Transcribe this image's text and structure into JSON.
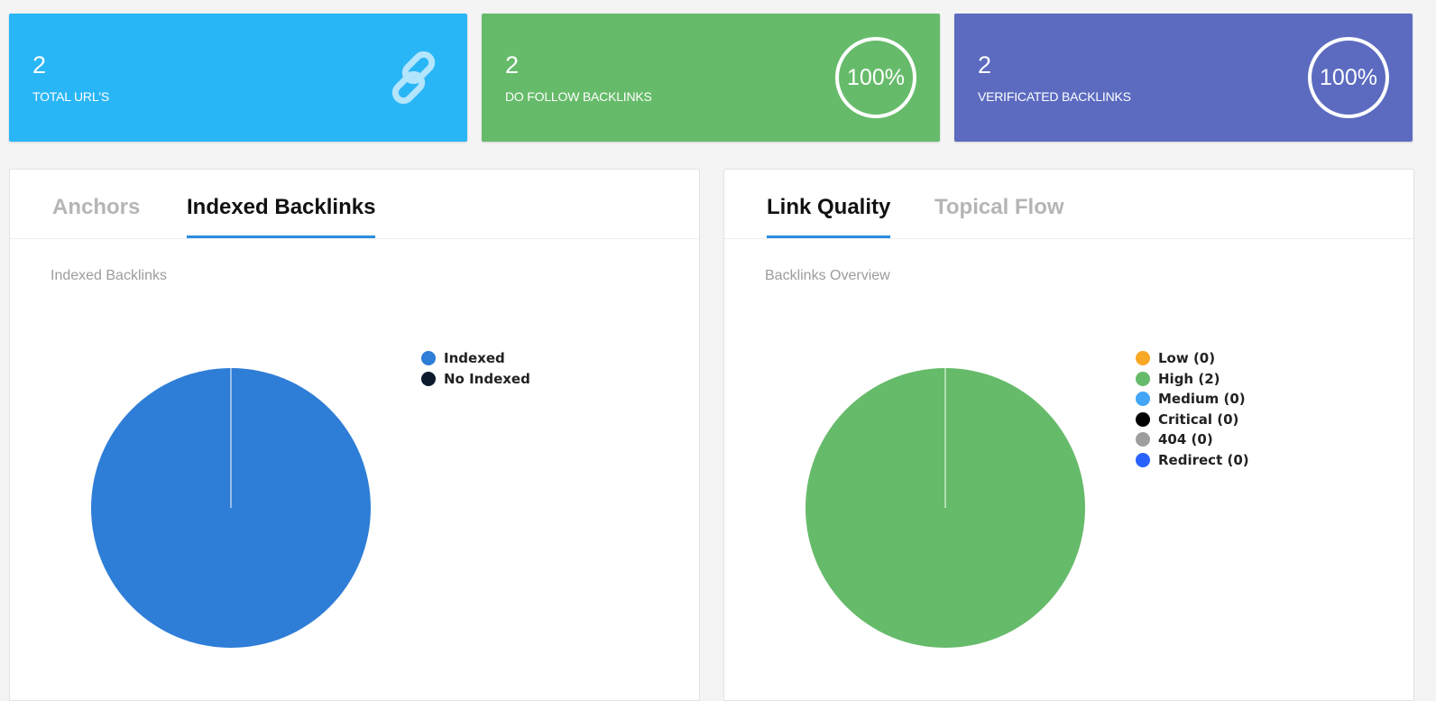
{
  "stats": [
    {
      "value": "2",
      "label": "TOTAL URL'S",
      "color": "#29b6f6",
      "icon": "link-icon"
    },
    {
      "value": "2",
      "label": "DO FOLLOW BACKLINKS",
      "color": "#66bb6a",
      "percent": "100%"
    },
    {
      "value": "2",
      "label": "VERIFICATED BACKLINKS",
      "color": "#5c6bc0",
      "percent": "100%"
    }
  ],
  "left_panel": {
    "tabs": [
      {
        "label": "Anchors",
        "active": false
      },
      {
        "label": "Indexed Backlinks",
        "active": true
      }
    ],
    "subtitle": "Indexed Backlinks",
    "chart_data": {
      "type": "pie",
      "title": "Indexed Backlinks",
      "categories": [
        "Indexed",
        "No Indexed"
      ],
      "values": [
        2,
        0
      ],
      "colors": [
        "#2e7dd7",
        "#0d1a2e"
      ],
      "legend": "right"
    }
  },
  "right_panel": {
    "tabs": [
      {
        "label": "Link Quality",
        "active": true
      },
      {
        "label": "Topical Flow",
        "active": false
      }
    ],
    "subtitle": "Backlinks Overview",
    "chart_data": {
      "type": "pie",
      "title": "Backlinks Overview",
      "categories": [
        "Low (0)",
        "High (2)",
        "Medium (0)",
        "Critical (0)",
        "404 (0)",
        "Redirect (0)"
      ],
      "values": [
        0,
        2,
        0,
        0,
        0,
        0
      ],
      "colors": [
        "#f9a825",
        "#66bb6a",
        "#42a5f5",
        "#000000",
        "#9e9e9e",
        "#2962ff"
      ],
      "legend": "right"
    }
  }
}
